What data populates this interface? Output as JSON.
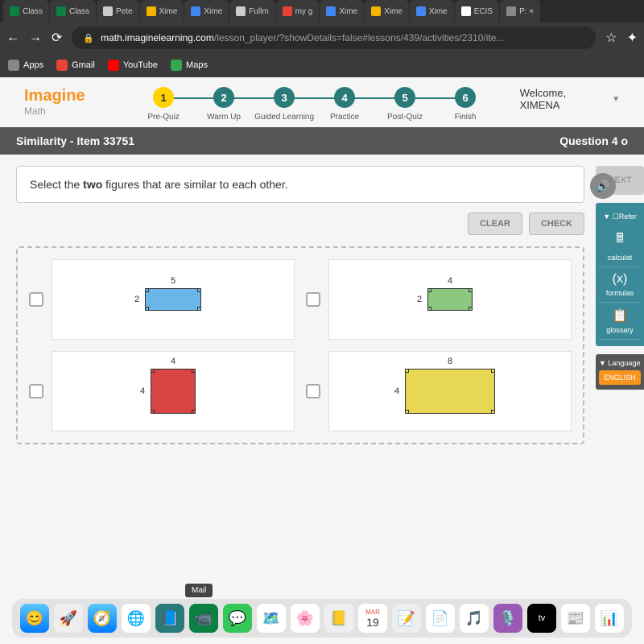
{
  "browser": {
    "tabs": [
      "Class",
      "Class",
      "Pete",
      "Xime",
      "Xime",
      "Fullm",
      "my g",
      "Xime",
      "Xime",
      "Xime",
      "ECIS",
      "P: ×"
    ],
    "url_host": "math.imaginelearning.com",
    "url_path": "/lesson_player/?showDetails=false#lessons/439/activities/2310/ite...",
    "bookmarks": {
      "apps": "Apps",
      "gmail": "Gmail",
      "youtube": "YouTube",
      "maps": "Maps"
    }
  },
  "app": {
    "logo": "Imagine",
    "logo_sub": "Math",
    "welcome": "Welcome, XIMENA",
    "steps": [
      {
        "num": "1",
        "label": "Pre-Quiz",
        "active": true
      },
      {
        "num": "2",
        "label": "Warm Up",
        "active": false
      },
      {
        "num": "3",
        "label": "Guided Learning",
        "active": false
      },
      {
        "num": "4",
        "label": "Practice",
        "active": false
      },
      {
        "num": "5",
        "label": "Post-Quiz",
        "active": false
      },
      {
        "num": "6",
        "label": "Finish",
        "active": false
      }
    ]
  },
  "item_bar": {
    "title": "Similarity - Item 33751",
    "question": "Question 4 o"
  },
  "prompt": {
    "text_pre": "Select the ",
    "text_bold": "two",
    "text_post": " figures that are similar to each other."
  },
  "buttons": {
    "clear": "CLEAR",
    "check": "CHECK",
    "next": "NEXT"
  },
  "figures": [
    {
      "color": "blue",
      "top": "5",
      "left": "2"
    },
    {
      "color": "green",
      "top": "4",
      "left": "2"
    },
    {
      "color": "red",
      "top": "4",
      "left": "4"
    },
    {
      "color": "yellow",
      "top": "8",
      "left": "4"
    }
  ],
  "tools": {
    "header": "▼ ☐Refer",
    "calc": "calculat",
    "formulas": "formulas",
    "glossary": "glossary"
  },
  "lang": {
    "header": "▼ Language",
    "btn": "ENGLISH"
  },
  "dock": {
    "tooltip": "Mail"
  }
}
